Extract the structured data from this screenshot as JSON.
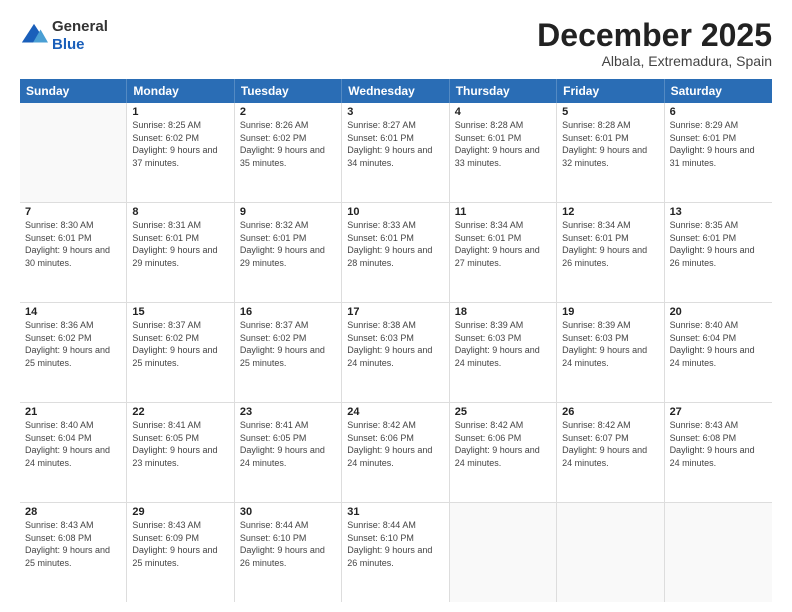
{
  "header": {
    "logo": {
      "general": "General",
      "blue": "Blue"
    },
    "title": "December 2025",
    "location": "Albala, Extremadura, Spain"
  },
  "days_of_week": [
    "Sunday",
    "Monday",
    "Tuesday",
    "Wednesday",
    "Thursday",
    "Friday",
    "Saturday"
  ],
  "weeks": [
    [
      {
        "day": "",
        "empty": true
      },
      {
        "day": "1",
        "sunrise": "8:25 AM",
        "sunset": "6:02 PM",
        "daylight": "9 hours and 37 minutes."
      },
      {
        "day": "2",
        "sunrise": "8:26 AM",
        "sunset": "6:02 PM",
        "daylight": "9 hours and 35 minutes."
      },
      {
        "day": "3",
        "sunrise": "8:27 AM",
        "sunset": "6:01 PM",
        "daylight": "9 hours and 34 minutes."
      },
      {
        "day": "4",
        "sunrise": "8:28 AM",
        "sunset": "6:01 PM",
        "daylight": "9 hours and 33 minutes."
      },
      {
        "day": "5",
        "sunrise": "8:28 AM",
        "sunset": "6:01 PM",
        "daylight": "9 hours and 32 minutes."
      },
      {
        "day": "6",
        "sunrise": "8:29 AM",
        "sunset": "6:01 PM",
        "daylight": "9 hours and 31 minutes."
      }
    ],
    [
      {
        "day": "7",
        "sunrise": "8:30 AM",
        "sunset": "6:01 PM",
        "daylight": "9 hours and 30 minutes."
      },
      {
        "day": "8",
        "sunrise": "8:31 AM",
        "sunset": "6:01 PM",
        "daylight": "9 hours and 29 minutes."
      },
      {
        "day": "9",
        "sunrise": "8:32 AM",
        "sunset": "6:01 PM",
        "daylight": "9 hours and 29 minutes."
      },
      {
        "day": "10",
        "sunrise": "8:33 AM",
        "sunset": "6:01 PM",
        "daylight": "9 hours and 28 minutes."
      },
      {
        "day": "11",
        "sunrise": "8:34 AM",
        "sunset": "6:01 PM",
        "daylight": "9 hours and 27 minutes."
      },
      {
        "day": "12",
        "sunrise": "8:34 AM",
        "sunset": "6:01 PM",
        "daylight": "9 hours and 26 minutes."
      },
      {
        "day": "13",
        "sunrise": "8:35 AM",
        "sunset": "6:01 PM",
        "daylight": "9 hours and 26 minutes."
      }
    ],
    [
      {
        "day": "14",
        "sunrise": "8:36 AM",
        "sunset": "6:02 PM",
        "daylight": "9 hours and 25 minutes."
      },
      {
        "day": "15",
        "sunrise": "8:37 AM",
        "sunset": "6:02 PM",
        "daylight": "9 hours and 25 minutes."
      },
      {
        "day": "16",
        "sunrise": "8:37 AM",
        "sunset": "6:02 PM",
        "daylight": "9 hours and 25 minutes."
      },
      {
        "day": "17",
        "sunrise": "8:38 AM",
        "sunset": "6:03 PM",
        "daylight": "9 hours and 24 minutes."
      },
      {
        "day": "18",
        "sunrise": "8:39 AM",
        "sunset": "6:03 PM",
        "daylight": "9 hours and 24 minutes."
      },
      {
        "day": "19",
        "sunrise": "8:39 AM",
        "sunset": "6:03 PM",
        "daylight": "9 hours and 24 minutes."
      },
      {
        "day": "20",
        "sunrise": "8:40 AM",
        "sunset": "6:04 PM",
        "daylight": "9 hours and 24 minutes."
      }
    ],
    [
      {
        "day": "21",
        "sunrise": "8:40 AM",
        "sunset": "6:04 PM",
        "daylight": "9 hours and 24 minutes."
      },
      {
        "day": "22",
        "sunrise": "8:41 AM",
        "sunset": "6:05 PM",
        "daylight": "9 hours and 23 minutes."
      },
      {
        "day": "23",
        "sunrise": "8:41 AM",
        "sunset": "6:05 PM",
        "daylight": "9 hours and 24 minutes."
      },
      {
        "day": "24",
        "sunrise": "8:42 AM",
        "sunset": "6:06 PM",
        "daylight": "9 hours and 24 minutes."
      },
      {
        "day": "25",
        "sunrise": "8:42 AM",
        "sunset": "6:06 PM",
        "daylight": "9 hours and 24 minutes."
      },
      {
        "day": "26",
        "sunrise": "8:42 AM",
        "sunset": "6:07 PM",
        "daylight": "9 hours and 24 minutes."
      },
      {
        "day": "27",
        "sunrise": "8:43 AM",
        "sunset": "6:08 PM",
        "daylight": "9 hours and 24 minutes."
      }
    ],
    [
      {
        "day": "28",
        "sunrise": "8:43 AM",
        "sunset": "6:08 PM",
        "daylight": "9 hours and 25 minutes."
      },
      {
        "day": "29",
        "sunrise": "8:43 AM",
        "sunset": "6:09 PM",
        "daylight": "9 hours and 25 minutes."
      },
      {
        "day": "30",
        "sunrise": "8:44 AM",
        "sunset": "6:10 PM",
        "daylight": "9 hours and 26 minutes."
      },
      {
        "day": "31",
        "sunrise": "8:44 AM",
        "sunset": "6:10 PM",
        "daylight": "9 hours and 26 minutes."
      },
      {
        "day": "",
        "empty": true
      },
      {
        "day": "",
        "empty": true
      },
      {
        "day": "",
        "empty": true
      }
    ]
  ]
}
